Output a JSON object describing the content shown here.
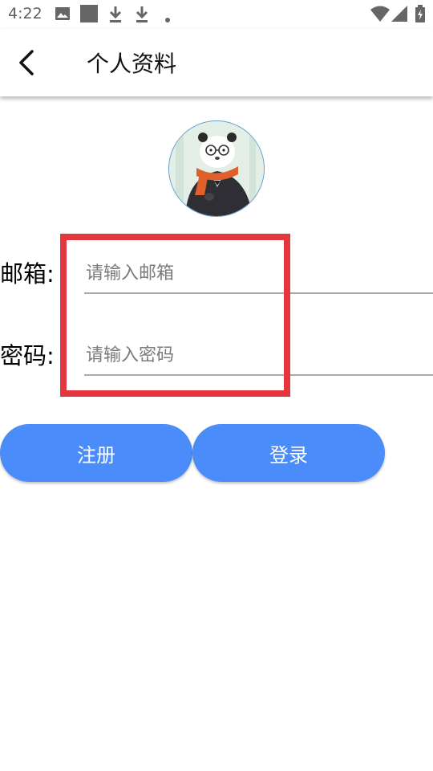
{
  "status_bar": {
    "time": "4:22",
    "icons": [
      "image-icon",
      "square-notification-icon",
      "download-icon",
      "download-icon",
      "dot-icon",
      "wifi-icon",
      "signal-icon",
      "battery-charging-icon"
    ]
  },
  "app_bar": {
    "title": "个人资料",
    "back_icon": "back-arrow-icon"
  },
  "form": {
    "email_label": "邮箱:",
    "email_placeholder": "请输入邮箱",
    "email_value": "",
    "password_label": "密码:",
    "password_placeholder": "请输入密码",
    "password_value": ""
  },
  "buttons": {
    "register_label": "注册",
    "login_label": "登录"
  },
  "colors": {
    "accent": "#4a8cfa",
    "highlight": "#e2373e",
    "underline": "#aaaaaa"
  }
}
